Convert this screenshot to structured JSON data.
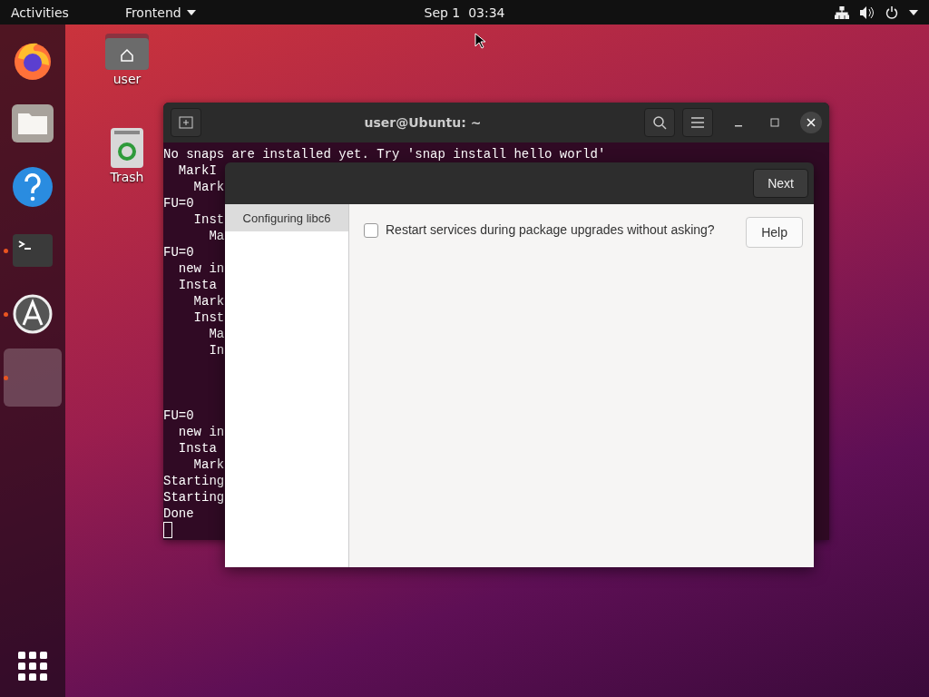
{
  "top_bar": {
    "activities": "Activities",
    "app_menu": "Frontend",
    "clock": "Sep 1  03:34"
  },
  "dock": {
    "items": [
      {
        "kind": "browser",
        "running": false,
        "selected": false
      },
      {
        "kind": "files",
        "running": false,
        "selected": false
      },
      {
        "kind": "help",
        "running": false,
        "selected": false
      },
      {
        "kind": "terminal",
        "running": true,
        "selected": false
      },
      {
        "kind": "software",
        "running": true,
        "selected": false
      },
      {
        "kind": "blank",
        "running": true,
        "selected": true
      }
    ]
  },
  "desktop_icons": [
    {
      "kind": "home",
      "label": "user"
    },
    {
      "kind": "trash",
      "label": "Trash"
    }
  ],
  "terminal": {
    "title": "user@Ubuntu: ~",
    "blocks": [
      [
        "No snaps are installed yet. Try 'snap install hello world'",
        "  MarkI",
        "    Mark",
        "FU=0",
        "    Inst",
        "      Ma",
        "FU=0",
        "  new in",
        "  Insta",
        "    Mark",
        "    Inst",
        "      Ma",
        "      In"
      ],
      [
        "FU=0",
        "  new in",
        "  Insta",
        "    Mark",
        "Starting",
        "Starting",
        "Done"
      ]
    ]
  },
  "dialog": {
    "next_button": "Next",
    "sidebar": [
      {
        "label": "Configuring libc6",
        "selected": true
      }
    ],
    "question": {
      "label": "Restart services during package upgrades without asking?",
      "checked": false
    },
    "help_button": "Help"
  }
}
